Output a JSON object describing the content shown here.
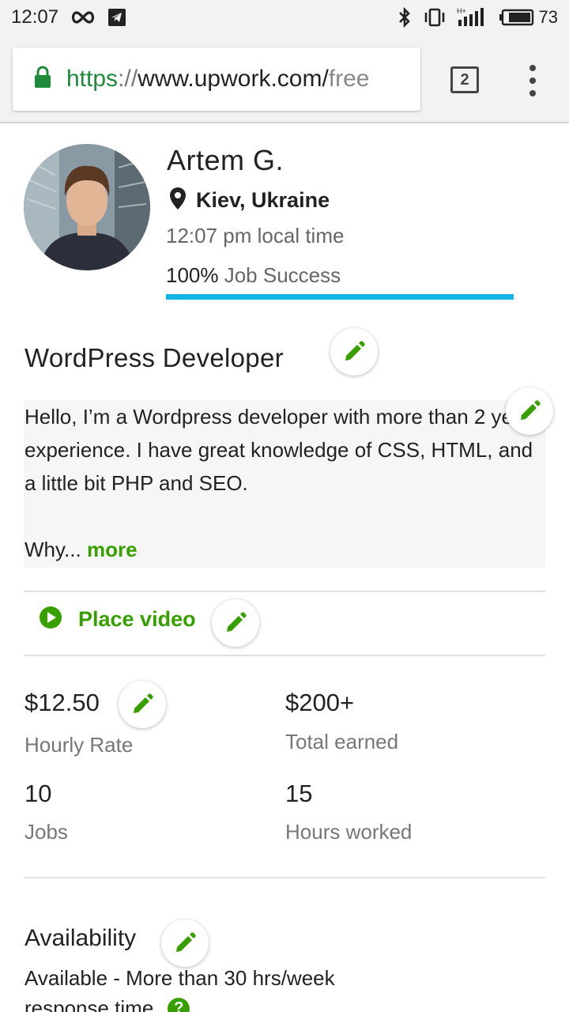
{
  "status_bar": {
    "time": "12:07",
    "icons": [
      "infinity-icon",
      "telegram-icon",
      "bluetooth-icon",
      "vibrate-icon",
      "signal-icon",
      "battery-icon"
    ],
    "signal_label": "H+",
    "battery_level": "73"
  },
  "browser": {
    "url_scheme": "https",
    "url_sep": "://",
    "url_host": "www.upwork.com/",
    "url_rest": "free",
    "tab_count": "2"
  },
  "profile": {
    "name": "Artem G.",
    "location": "Kiev, Ukraine",
    "local_time": "12:07 pm local time",
    "job_success_pct": "100%",
    "job_success_label": " Job Success",
    "job_success_fraction": 1.0,
    "title": "WordPress Developer",
    "overview": "Hello, I’m a Wordpress developer with more than 2 year experience. I have great knowledge of CSS, HTML, and a little bit PHP and SEO.",
    "overview_tail": "Why...",
    "more_link": "more",
    "video_label": "Place video"
  },
  "stats": {
    "hourly_rate_value": "$12.50",
    "hourly_rate_label": "Hourly Rate",
    "total_earned_value": "$200+",
    "total_earned_label": "Total earned",
    "jobs_value": "10",
    "jobs_label": "Jobs",
    "hours_value": "15",
    "hours_label": "Hours worked"
  },
  "availability": {
    "title": "Availability",
    "text": "Available - More than 30 hrs/week",
    "response_label": "response time"
  },
  "colors": {
    "brand_green": "#37a000",
    "progress_blue": "#14b4e6",
    "url_green": "#1e8a3a"
  }
}
